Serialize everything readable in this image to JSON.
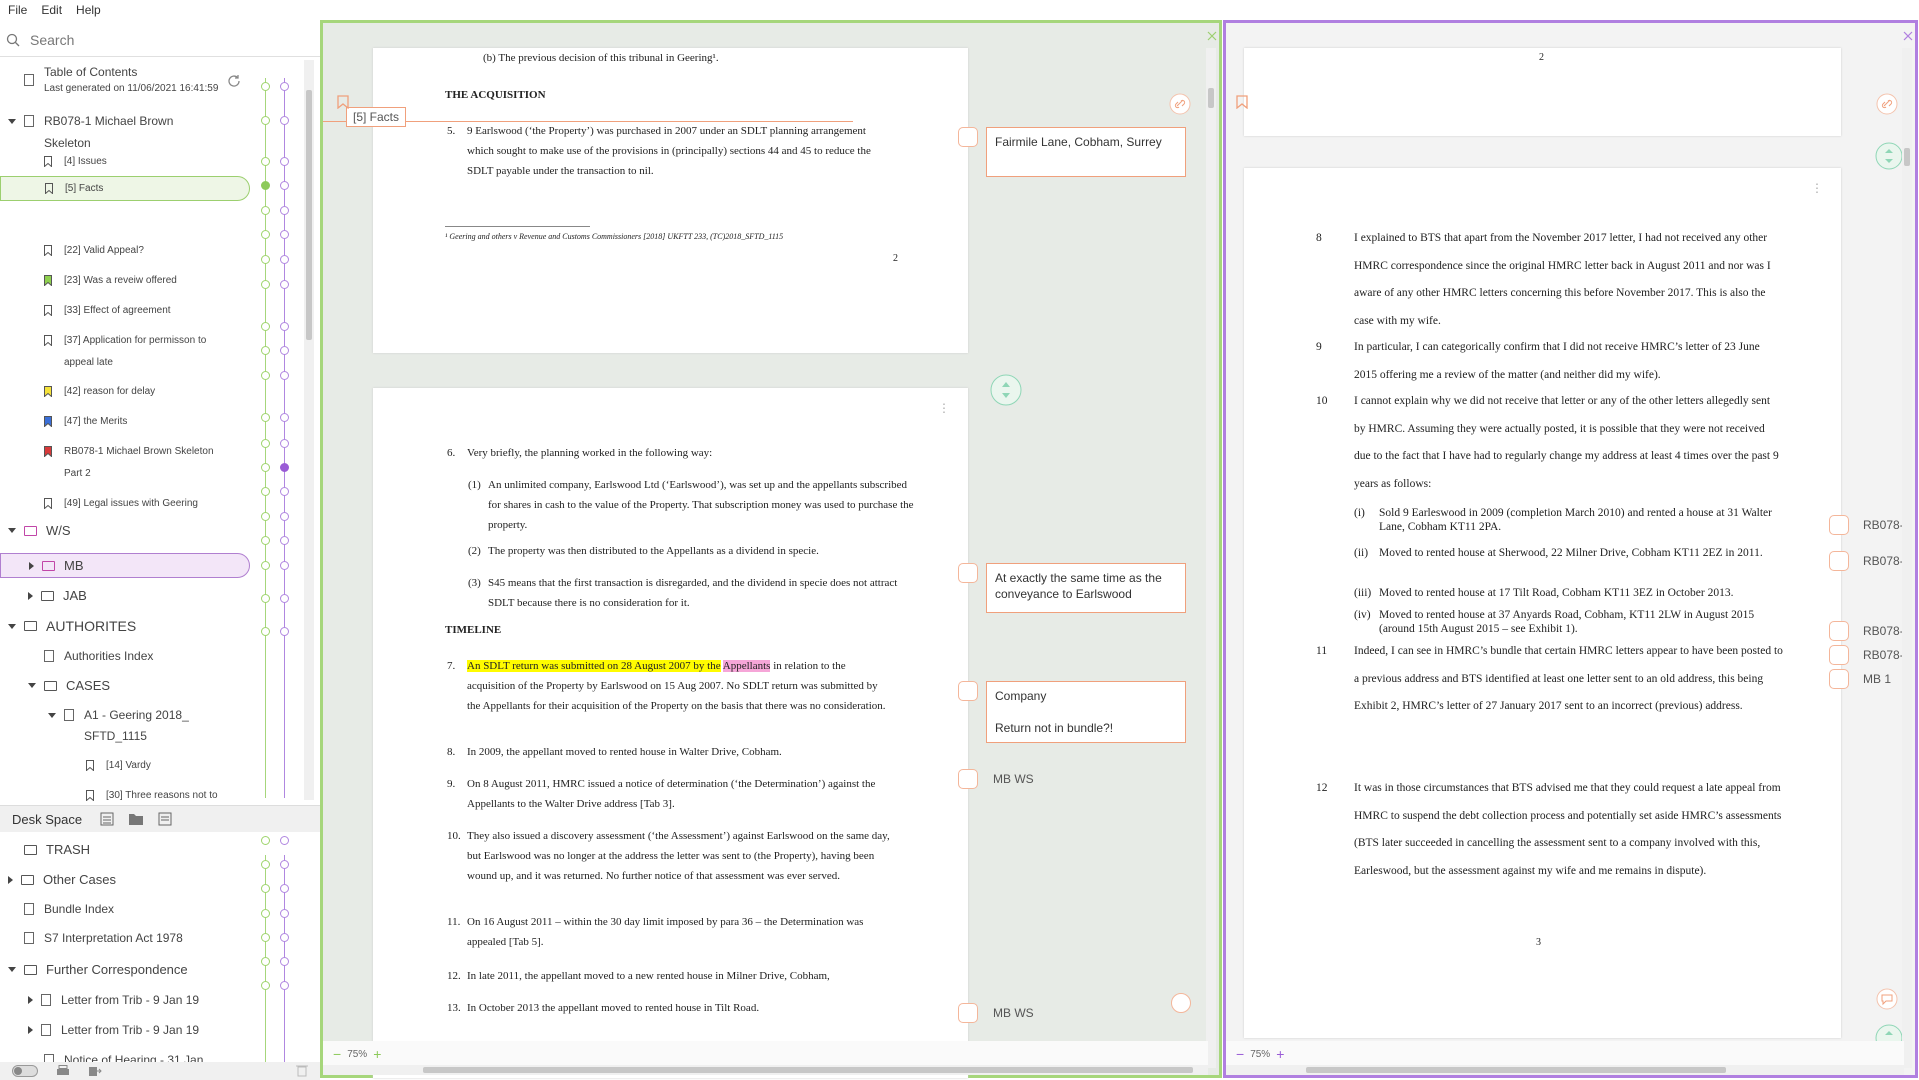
{
  "menu": [
    "File",
    "Edit",
    "Help"
  ],
  "search": {
    "placeholder": "Search"
  },
  "toc": {
    "title": "Table of Contents",
    "subtitle": "Last generated on 11/06/2021 16:41:59"
  },
  "tree": {
    "rb078": "RB078-1 Michael Brown",
    "rb078_2": "Skeleton",
    "items": [
      "[4] Issues",
      "[5] Facts",
      "[22] Valid Appeal?",
      "[23] Was a reveiw offered",
      "[33] Effect of agreement",
      "[37] Application for permisson to",
      "appeal late",
      "[42] reason for delay",
      "[47] the Merits",
      "RB078-1 Michael Brown Skeleton",
      "Part 2",
      "[49] Legal issues with Geering"
    ],
    "ws": "W/S",
    "mb": "MB",
    "jab": "JAB",
    "authorities": "AUTHORITES",
    "auth_index": "Authorities Index",
    "cases": "CASES",
    "geering1": "A1 - Geering 2018_",
    "geering2": "SFTD_1115",
    "vardy": "[14] Vardy",
    "three": "[30] Three reasons not to"
  },
  "desk": {
    "label": "Desk Space",
    "trash": "TRASH",
    "other": "Other Cases",
    "bundle": "Bundle Index",
    "s7": "S7 Interpretation Act 1978",
    "further": "Further Correspondence",
    "letter1": "Letter from Trib - 9 Jan 19",
    "letter2": "Letter from Trib - 9 Jan 19",
    "notice": "Notice of Hearing - 31 Jan"
  },
  "left_doc": {
    "facts_tab": "[5] Facts",
    "top_line": "(b)  The previous decision of this tribunal in Geering¹.",
    "heading1": "THE ACQUISITION",
    "p5_n": "5.",
    "p5": "9 Earlswood (‘the Property’) was purchased in 2007 under an SDLT planning arrangement which sought to make use of the provisions in (principally) sections 44 and 45 to reduce the SDLT payable under the transaction to nil.",
    "footnote": "¹ Geering and others v Revenue and Customs Commissioners [2018] UKFTT 233, (TC)2018_SFTD_1115",
    "page_num": "2",
    "p6_n": "6.",
    "p6": "Very briefly, the planning worked in the following way:",
    "s1_n": "(1)",
    "s1": "An unlimited company, Earlswood Ltd (‘Earlswood’), was set up and the appellants subscribed for shares in cash to the value of the Property. That subscription money was used to purchase the property.",
    "s2_n": "(2)",
    "s2": "The property was then distributed to the Appellants as a dividend in specie.",
    "s3_n": "(3)",
    "s3": "S45 means that the first transaction is disregarded, and the dividend in specie does not attract SDLT because there is no consideration for it.",
    "heading2": "TIMELINE",
    "p7_n": "7.",
    "p7_hl": "An SDLT return was submitted on 28 August 2007 by the",
    "p7_hl2": "Appellants",
    "p7_rest": "in relation to the acquisition of the Property by Earlswood on 15 Aug 2007. No SDLT return was submitted by the Appellants for their acquisition of the Property on the basis that there was no consideration.",
    "p8_n": "8.",
    "p8": "In 2009, the appellant moved to rented house in Walter Drive, Cobham.",
    "p9_n": "9.",
    "p9": "On 8 August 2011, HMRC issued a notice of determination (‘the Determination’) against the Appellants to the Walter Drive address [Tab 3].",
    "p10_n": "10.",
    "p10": "They also issued a discovery assessment (‘the Assessment’) against Earlswood on the same day, but Earlswood was no longer at the address the letter was sent to (the Property), having been wound up, and it was returned. No further notice of that assessment was ever served.",
    "p11_n": "11.",
    "p11": "On 16 August 2011 – within the 30 day limit imposed by para 36 – the Determination was appealed [Tab 5].",
    "p12_n": "12.",
    "p12": "In late 2011, the appellant moved to a new rented house in Milner Drive, Cobham,",
    "p13_n": "13.",
    "p13": "In October 2013 the appellant moved to rented house in Tilt Road.",
    "zoom": "75%"
  },
  "notes": {
    "n1": "Fairmile Lane, Cobham, Surrey",
    "n2": "At exactly the same time as the conveyance to Earlswood",
    "n3a": "Company",
    "n3b": "Return not in bundle?!",
    "mbws1": "MB WS",
    "mbws2": "MB WS"
  },
  "right_doc": {
    "top_num": "2",
    "p8_n": "8",
    "p8": "I explained to BTS that apart from the November 2017 letter, I had not received any other HMRC correspondence since the original HMRC letter back in August 2011 and nor was I aware of any other HMRC letters concerning this before November 2017. This is also the case with my wife.",
    "p9_n": "9",
    "p9": "In particular, I can categorically confirm that I did not receive HMRC’s letter of 23 June 2015 offering me a review of the matter (and neither did my wife).",
    "p10_n": "10",
    "p10": "I cannot explain why we did not receive that letter or any of the other letters allegedly sent by HMRC. Assuming they were actually posted, it is possible that they were not received due to the fact that I have had to regularly change my address at least 4 times over the past 9 years as follows:",
    "i_n": "(i)",
    "i": "Sold 9 Earleswood in 2009 (completion March 2010) and rented a house at 31 Walter Lane, Cobham KT11 2PA.",
    "ii_n": "(ii)",
    "ii": "Moved to rented house at Sherwood, 22 Milner Drive, Cobham KT11 2EZ in 2011.",
    "iii_n": "(iii)",
    "iii": "Moved to rented house at 17 Tilt Road, Cobham KT11 3EZ in October 2013.",
    "iv_n": "(iv)",
    "iv": "Moved to rented house at 37 Anyards Road, Cobham, KT11 2LW in August 2015 (around 15th August 2015 – see Exhibit 1).",
    "p11_n": "11",
    "p11": "Indeed, I can see in HMRC’s bundle that certain HMRC letters appear to have been posted to a previous address and BTS identified at least one letter sent to an old address, this being Exhibit 2, HMRC’s letter of 27 January 2017 sent to an incorrect (previous) address.",
    "p12_n": "12",
    "p12": "It was in those circumstances that BTS advised me that they could request a late appeal from HMRC to suspend the debt collection process and potentially set aside HMRC’s assessments (BTS later succeeded in cancelling the assessment sent to a company involved with this, Earleswood, but the assessment against my wife and me remains in dispute).",
    "page_num": "3",
    "zoom": "75%",
    "links": [
      "RB078-",
      "RB078-",
      "RB078-",
      "RB078-",
      "MB 1"
    ]
  },
  "colors": {
    "green": "#a6d67b",
    "purple": "#b07fe0",
    "orange": "#f0a07c"
  }
}
